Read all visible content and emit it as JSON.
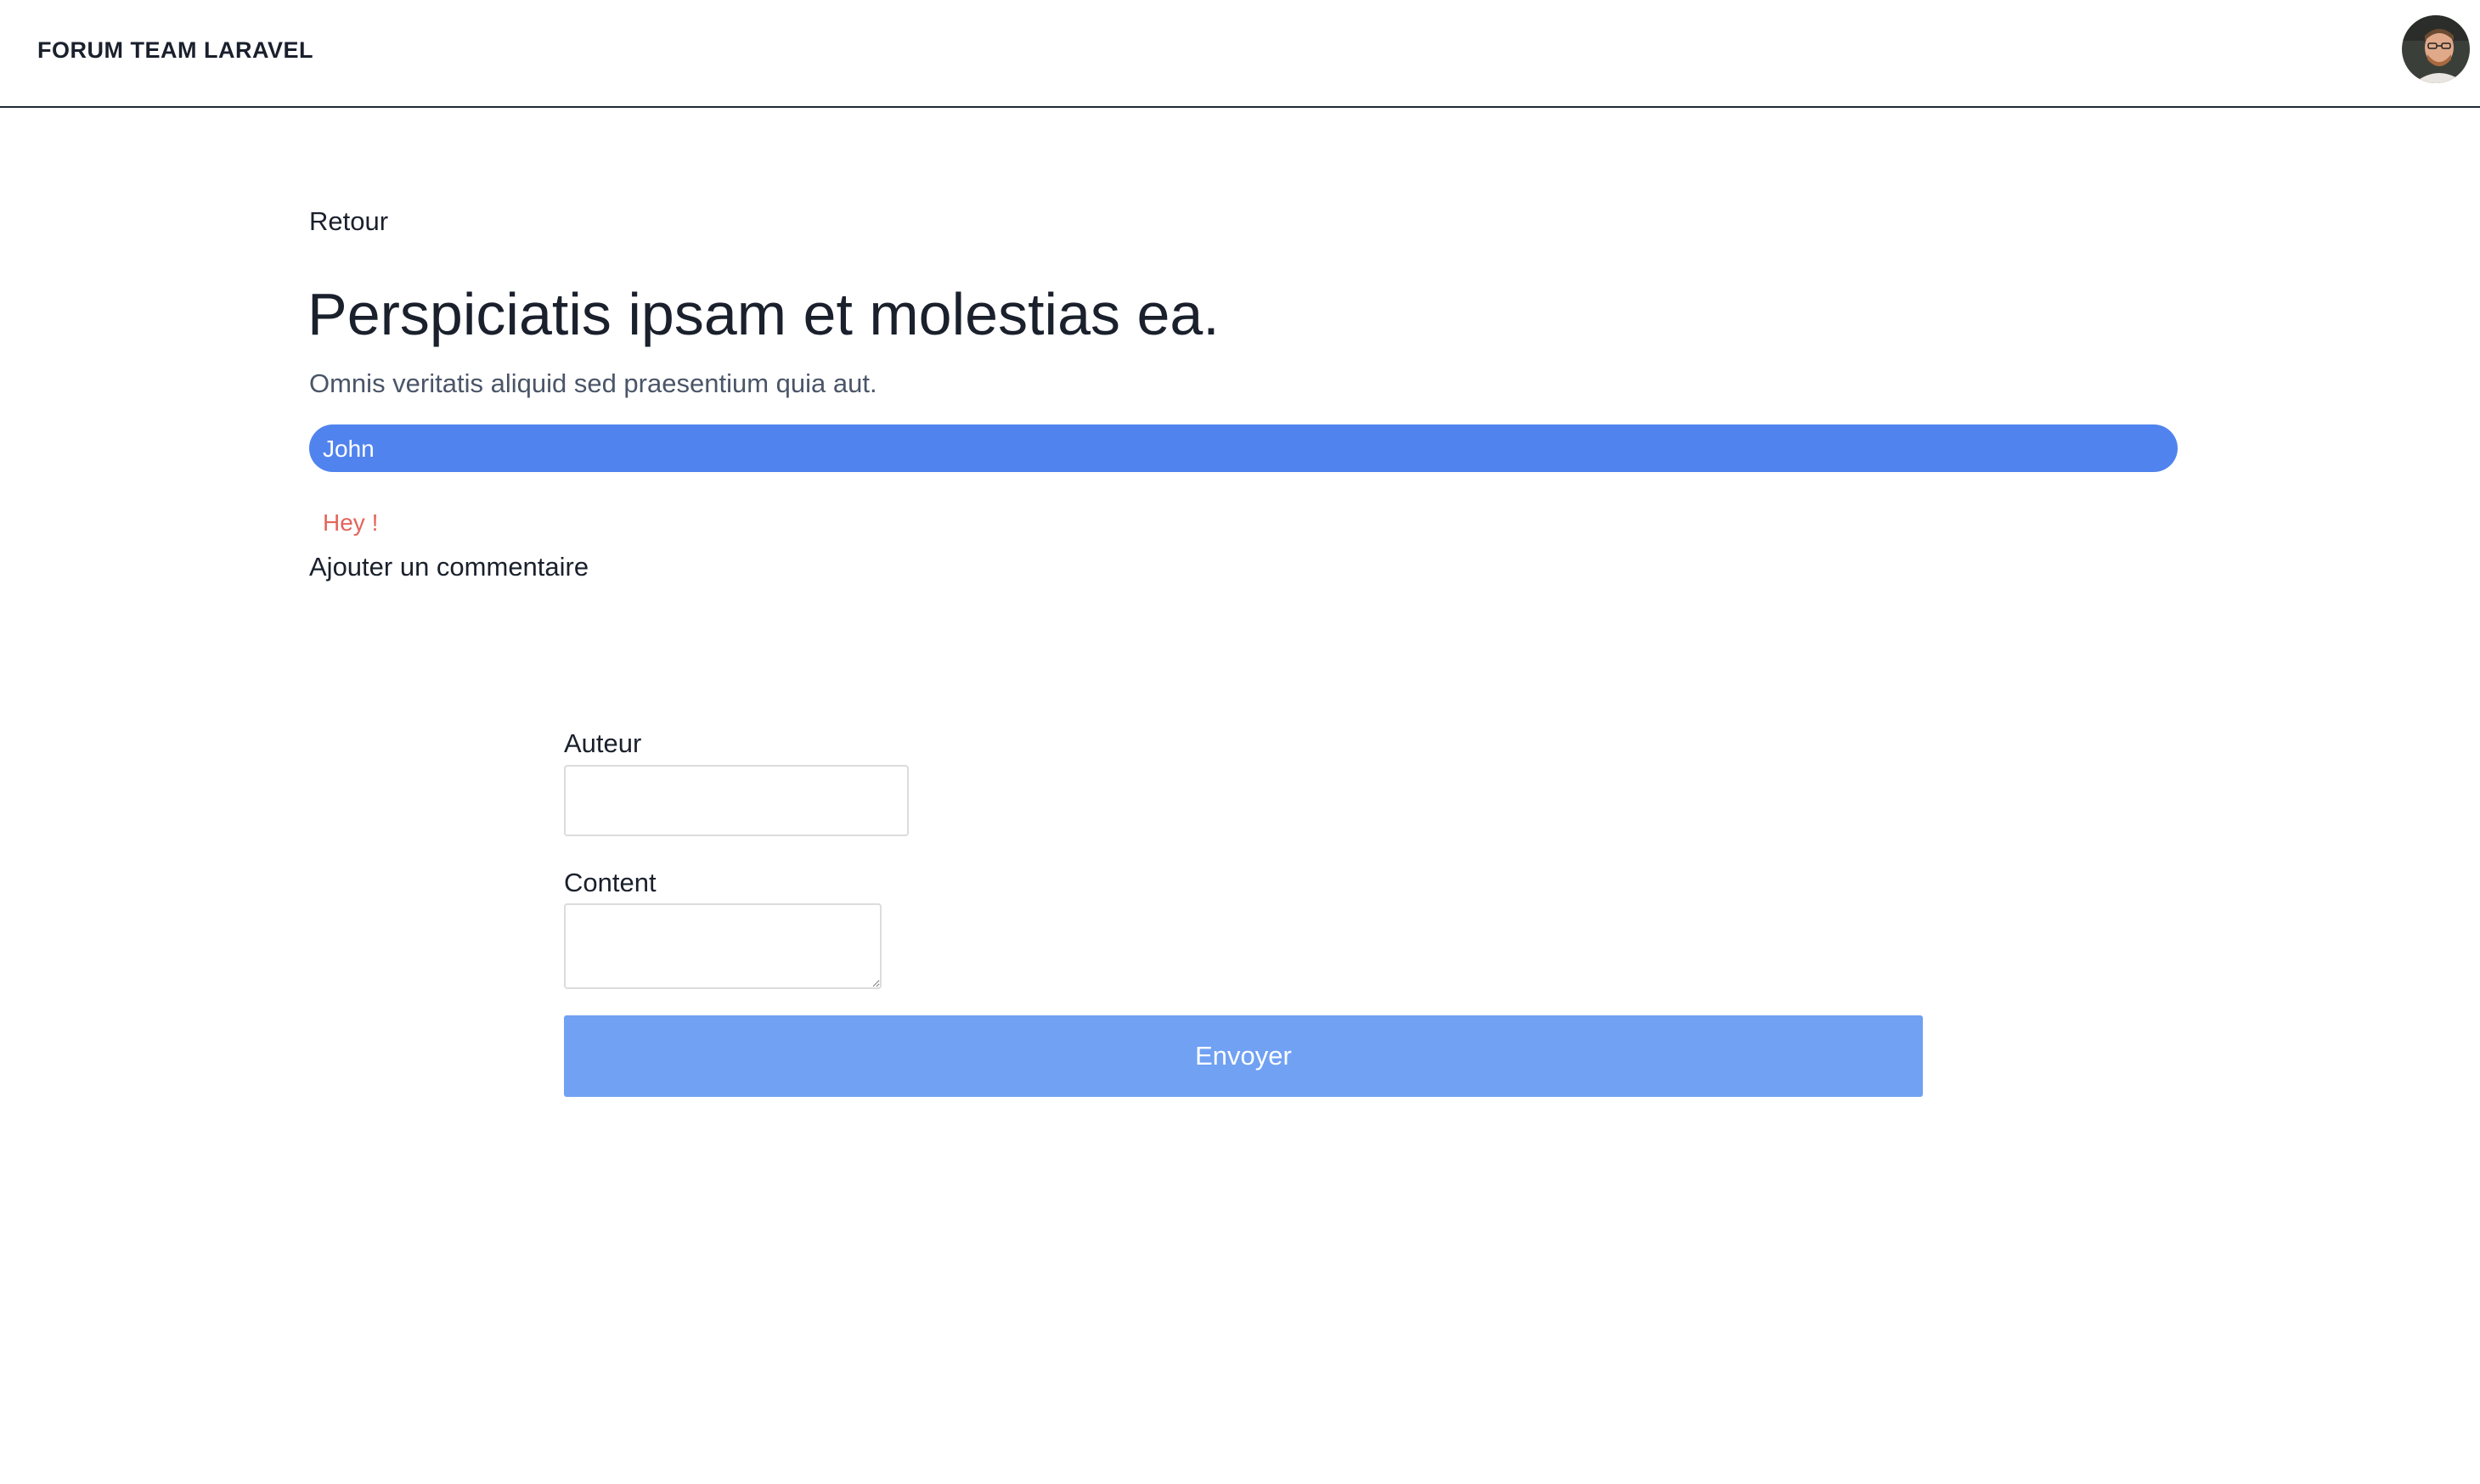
{
  "navbar": {
    "brand": "FORUM TEAM LARAVEL"
  },
  "icons": {
    "avatar": "user-avatar-icon"
  },
  "post": {
    "back_label": "Retour",
    "title": "Perspiciatis ipsam et molestias ea.",
    "subtitle": "Omnis veritatis aliquid sed praesentium quia aut.",
    "author": "John",
    "comments": [
      {
        "content": "Hey !"
      }
    ]
  },
  "comment_form": {
    "heading": "Ajouter un commentaire",
    "author_label": "Auteur",
    "author_value": "",
    "content_label": "Content",
    "content_value": "",
    "submit_label": "Envoyer"
  },
  "colors": {
    "accent": "#5083ee",
    "button": "#70a1f3",
    "comment_text": "#e3655b",
    "subtitle_text": "#4a5568"
  }
}
